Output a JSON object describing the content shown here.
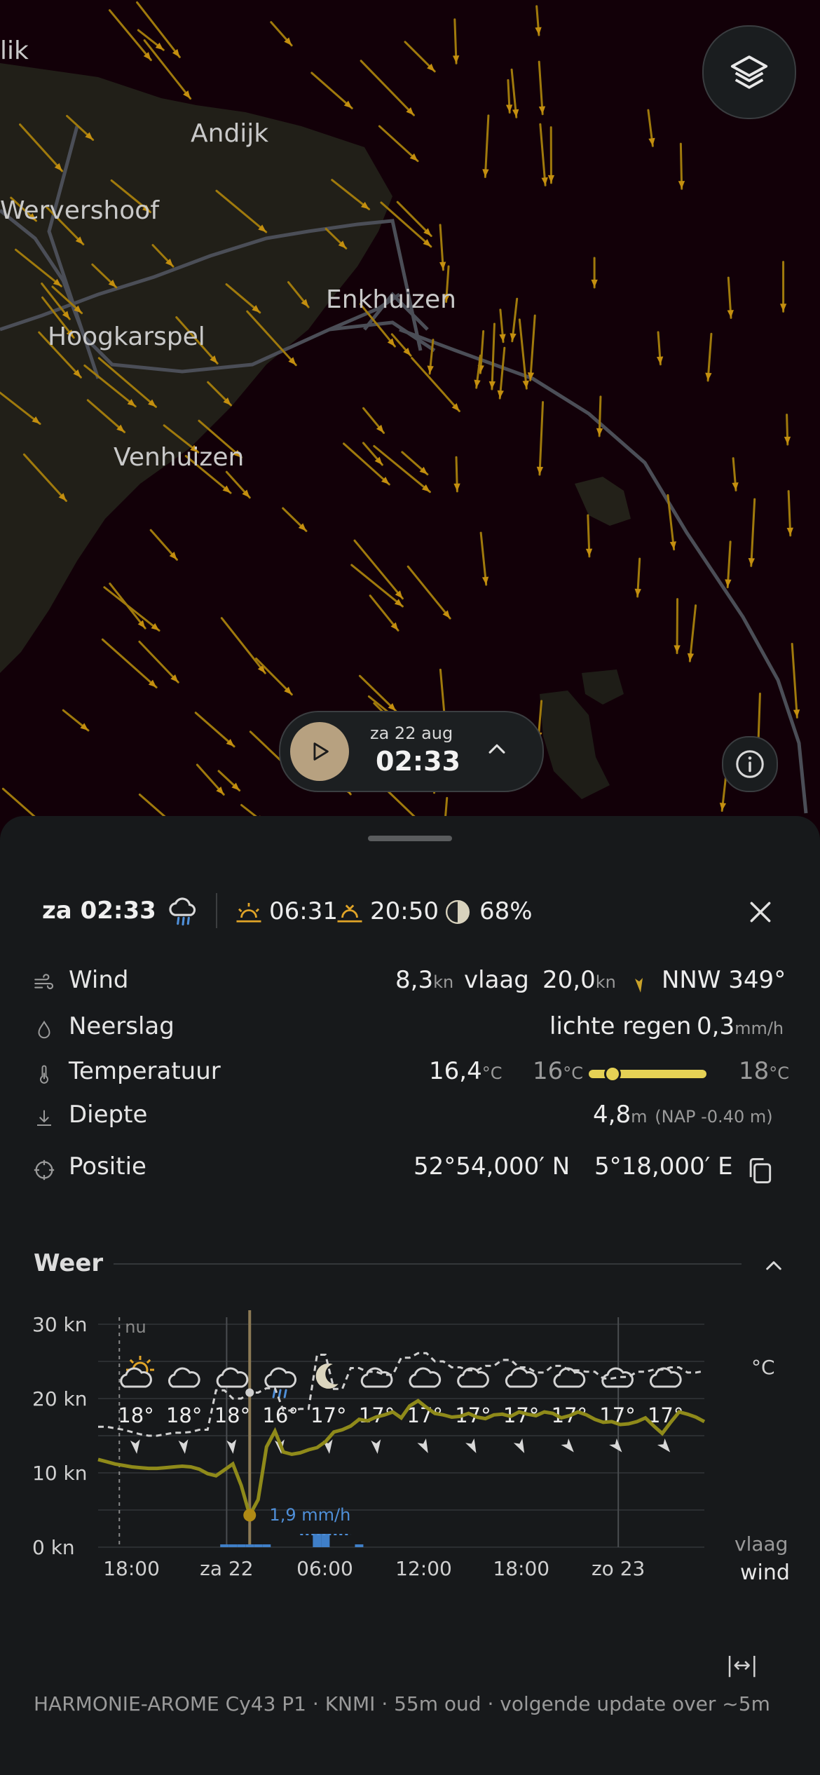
{
  "map": {
    "places": [
      "lik",
      "Andijk",
      "Wervershoof",
      "Enkhuizen",
      "Hoogkarspel",
      "Venhuizen"
    ]
  },
  "player": {
    "date": "za 22 aug",
    "time": "02:33"
  },
  "summary": {
    "time": "za 02:33",
    "sunrise": "06:31",
    "sunset": "20:50",
    "moon_pct": "68%"
  },
  "rows": {
    "wind": {
      "label": "Wind",
      "speed": "8,3",
      "unit": "kn",
      "gust_label": "vlaag",
      "gust": "20,0",
      "gust_unit": "kn",
      "direction": "NNW 349°"
    },
    "rain": {
      "label": "Neerslag",
      "desc": "lichte regen",
      "value": "0,3",
      "unit": "mm/h"
    },
    "temp": {
      "label": "Temperatuur",
      "value": "16,4",
      "unit": "°C",
      "min": "16",
      "min_unit": "°C",
      "max": "18",
      "max_unit": "°C",
      "slider_fraction": 0.2
    },
    "depth": {
      "label": "Diepte",
      "value": "4,8",
      "unit": "m",
      "nap": "(NAP -0.40 m)"
    },
    "position": {
      "label": "Positie",
      "lat": "52°54,000′ N",
      "lon": "5°18,000′ E"
    }
  },
  "weather": {
    "title": "Weer",
    "celsius": "°C",
    "icons": [
      "sun-cloud",
      "cloud",
      "cloud",
      "rain",
      "moon",
      "cloud",
      "cloud",
      "cloud",
      "cloud",
      "cloud",
      "cloud",
      "cloud"
    ],
    "temps": [
      "18°",
      "18°",
      "18°",
      "16°",
      "17°",
      "17°",
      "17°",
      "17°",
      "17°",
      "17°",
      "17°",
      "17°"
    ],
    "legend_gust": "vlaag",
    "legend_wind": "wind",
    "now_label": "nu",
    "rain_label": "1,9 mm/h",
    "resize_icon": "|↔|",
    "footer": "HARMONIE-AROME Cy43 P1 · KNMI · 55m oud · volgende update over ~5m"
  },
  "chart_data": {
    "type": "line",
    "title": "",
    "ylabel": "",
    "ylim": [
      0,
      30
    ],
    "y_ticks": [
      "0 kn",
      "10 kn",
      "20 kn",
      "30 kn"
    ],
    "x_ticks": [
      "18:00",
      "za 22",
      "06:00",
      "12:00",
      "18:00",
      "zo 23"
    ],
    "series": [
      {
        "name": "wind",
        "color": "#8f8a1a",
        "values": [
          11.8,
          11.5,
          11.2,
          11.0,
          10.8,
          10.7,
          10.6,
          10.6,
          10.7,
          10.8,
          10.9,
          10.8,
          10.5,
          9.9,
          9.6,
          10.4,
          11.2,
          8.3,
          4.3,
          6.4,
          13.5,
          15.6,
          12.8,
          12.5,
          12.7,
          13.1,
          13.4,
          14.2,
          15.5,
          15.8,
          16.3,
          17.2,
          17.0,
          17.5,
          17.8,
          18.2,
          17.4,
          19.0,
          19.7,
          18.8,
          18.0,
          17.8,
          17.5,
          17.6,
          18.0,
          17.5,
          17.3,
          17.8,
          17.9,
          17.6,
          18.2,
          17.9,
          17.7,
          18.2,
          18.0,
          17.4,
          17.7,
          18.2,
          17.8,
          17.2,
          16.8,
          16.9,
          16.5,
          16.6,
          16.9,
          17.4,
          16.3,
          15.3,
          16.8,
          18.2,
          17.9,
          17.5,
          16.9
        ]
      },
      {
        "name": "vlaag",
        "color": "#cfcfcf",
        "values": [
          16.2,
          16.2,
          16.0,
          15.8,
          15.5,
          15.2,
          15.0,
          15.0,
          15.2,
          15.4,
          15.4,
          15.5,
          15.8,
          15.8,
          21.1,
          21.1,
          20.0,
          20.0,
          20.8,
          20.8,
          21.4,
          21.4,
          18.4,
          18.4,
          18.6,
          18.6,
          25.9,
          25.9,
          21.3,
          21.3,
          24.1,
          24.1,
          23.6,
          23.6,
          23.2,
          23.2,
          25.5,
          25.5,
          26.1,
          26.1,
          25.0,
          25.0,
          24.2,
          24.2,
          23.8,
          23.8,
          24.4,
          24.4,
          25.2,
          25.2,
          24.2,
          24.2,
          23.5,
          23.5,
          24.4,
          24.4,
          23.8,
          23.8,
          23.6,
          23.6,
          22.7,
          22.7,
          22.9,
          22.9,
          23.6,
          23.6,
          23.9,
          23.9,
          24.2,
          24.2,
          23.5,
          23.5,
          23.7
        ]
      }
    ],
    "rain_mm_h": [
      0,
      0,
      0,
      0,
      0,
      0,
      0,
      0,
      0,
      0,
      0,
      0,
      0,
      0,
      0,
      0.15,
      0.1,
      0.2,
      0.3,
      0.2,
      0.1,
      0,
      0,
      0,
      0,
      0,
      1.9,
      1.9,
      0,
      0,
      0,
      0.05,
      0,
      0,
      0,
      0,
      0,
      0,
      0,
      0,
      0,
      0,
      0,
      0,
      0,
      0,
      0,
      0,
      0,
      0,
      0,
      0,
      0,
      0,
      0,
      0,
      0,
      0,
      0,
      0,
      0,
      0,
      0,
      0,
      0,
      0,
      0,
      0,
      0,
      0,
      0,
      0,
      0
    ]
  }
}
